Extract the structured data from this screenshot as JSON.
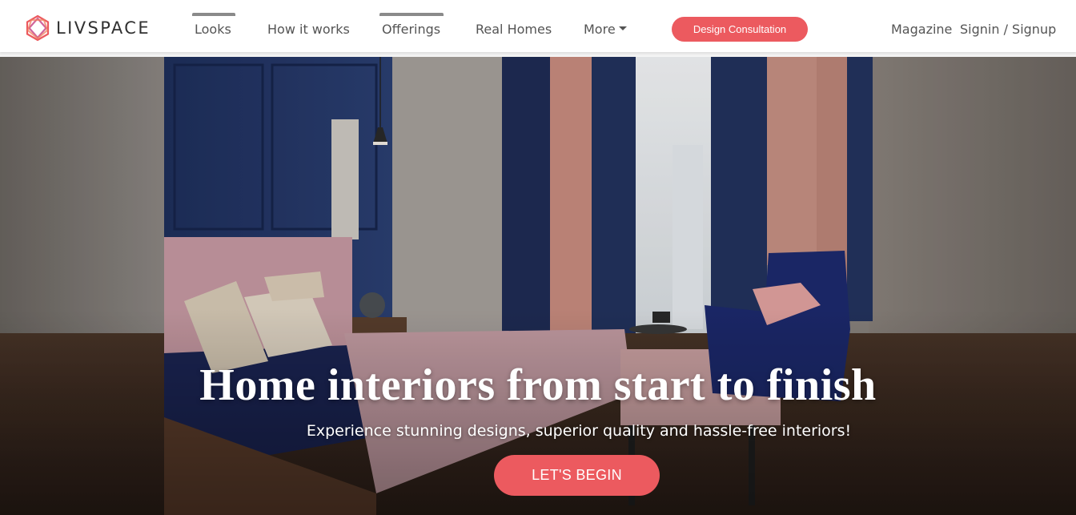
{
  "brand": {
    "name": "LIVSPACE",
    "accent": "#ec5a5f"
  },
  "nav": {
    "items": [
      {
        "label": "Looks"
      },
      {
        "label": "How it works"
      },
      {
        "label": "Offerings"
      },
      {
        "label": "Real Homes"
      },
      {
        "label": "More"
      }
    ],
    "consult_label": "Design Consultation",
    "magazine_label": "Magazine",
    "signin_label": "Signin / Signup"
  },
  "hero": {
    "title": "Home interiors from start to finish",
    "subtitle": "Experience stunning designs, superior quality and hassle-free interiors!",
    "cta_label": "LET'S BEGIN"
  },
  "icons": {
    "logo": "livspace-hexagon-icon",
    "more_caret": "caret-down-icon"
  }
}
